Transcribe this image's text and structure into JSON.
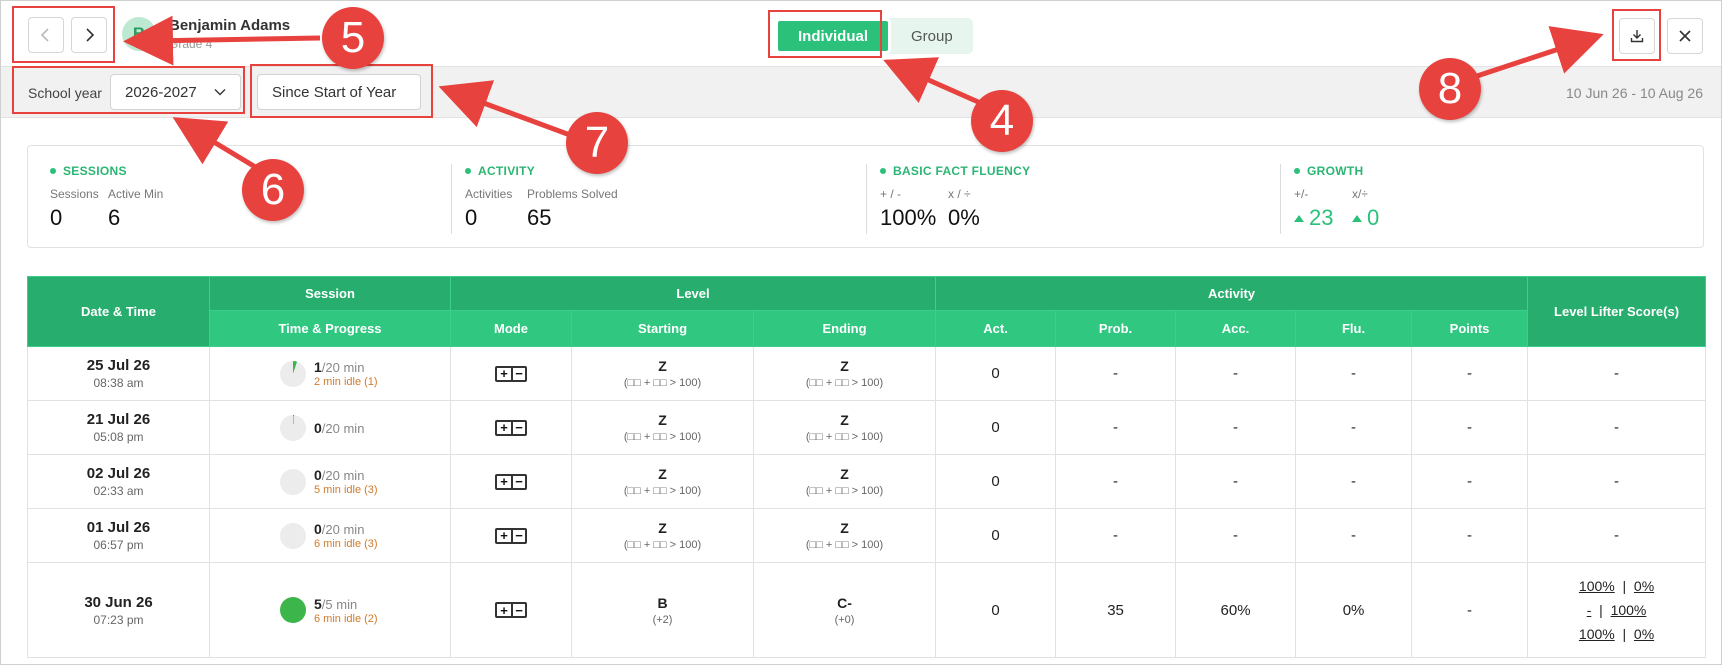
{
  "header": {
    "avatar_initial": "B",
    "student_name": "Benjamin Adams",
    "student_grade": "Grade 4",
    "toggle": {
      "individual": "Individual",
      "group": "Group"
    }
  },
  "filters": {
    "school_year_label": "School year",
    "school_year_value": "2026-2027",
    "period_value": "Since Start of Year",
    "date_range": "10 Jun 26 - 10 Aug 26"
  },
  "stats": {
    "sessions": {
      "title": "SESSIONS",
      "label1": "Sessions",
      "value1": "0",
      "label2": "Active Min",
      "value2": "6"
    },
    "activity": {
      "title": "ACTIVITY",
      "label1": "Activities",
      "value1": "0",
      "label2": "Problems Solved",
      "value2": "65"
    },
    "fluency": {
      "title": "BASIC FACT FLUENCY",
      "label1": "+ / -",
      "value1": "100%",
      "label2": "x / ÷",
      "value2": "0%"
    },
    "growth": {
      "title": "GROWTH",
      "label1": "+/-",
      "value1": "23",
      "label2": "x/÷",
      "value2": "0"
    }
  },
  "table": {
    "headers": {
      "datetime": "Date & Time",
      "session": "Session",
      "level": "Level",
      "activity": "Activity",
      "lls": "Level Lifter Score(s)",
      "time_progress": "Time & Progress",
      "mode": "Mode",
      "starting": "Starting",
      "ending": "Ending",
      "act": "Act.",
      "prob": "Prob.",
      "acc": "Acc.",
      "flu": "Flu.",
      "points": "Points"
    },
    "rows": [
      {
        "date": "25 Jul 26",
        "time": "08:38 am",
        "minutes": "1",
        "total": "/20 min",
        "idle": "2 min idle (1)",
        "progress": 0.05,
        "start": "Z",
        "start_sub": "(□□ + □□ > 100)",
        "end": "Z",
        "end_sub": "(□□ + □□ > 100)",
        "act": "0",
        "prob": "-",
        "acc": "-",
        "flu": "-",
        "points": "-",
        "lls": "-"
      },
      {
        "date": "21 Jul 26",
        "time": "05:08 pm",
        "minutes": "0",
        "total": "/20 min",
        "idle": "",
        "progress": 0.01,
        "start": "Z",
        "start_sub": "(□□ + □□ > 100)",
        "end": "Z",
        "end_sub": "(□□ + □□ > 100)",
        "act": "0",
        "prob": "-",
        "acc": "-",
        "flu": "-",
        "points": "-",
        "lls": "-"
      },
      {
        "date": "02 Jul 26",
        "time": "02:33 am",
        "minutes": "0",
        "total": "/20 min",
        "idle": "5 min idle (3)",
        "progress": 0,
        "start": "Z",
        "start_sub": "(□□ + □□ > 100)",
        "end": "Z",
        "end_sub": "(□□ + □□ > 100)",
        "act": "0",
        "prob": "-",
        "acc": "-",
        "flu": "-",
        "points": "-",
        "lls": "-"
      },
      {
        "date": "01 Jul 26",
        "time": "06:57 pm",
        "minutes": "0",
        "total": "/20 min",
        "idle": "6 min idle (3)",
        "progress": 0,
        "start": "Z",
        "start_sub": "(□□ + □□ > 100)",
        "end": "Z",
        "end_sub": "(□□ + □□ > 100)",
        "act": "0",
        "prob": "-",
        "acc": "-",
        "flu": "-",
        "points": "-",
        "lls": "-"
      },
      {
        "date": "30 Jun 26",
        "time": "07:23 pm",
        "minutes": "5",
        "total": "/5 min",
        "idle": "6 min idle (2)",
        "progress": 1,
        "start": "B",
        "start_sub": "(+2)",
        "end": "C-",
        "end_sub": "(+0)",
        "act": "0",
        "prob": "35",
        "acc": "60%",
        "flu": "0%",
        "points": "-",
        "lls_lines": [
          [
            "100%",
            "0%"
          ],
          [
            "-",
            "100%"
          ],
          [
            "100%",
            "0%"
          ]
        ]
      }
    ]
  },
  "annotations": [
    "5",
    "4",
    "6",
    "7",
    "8"
  ],
  "colors": {
    "accent": "#2bc17b",
    "header_dark": "#27ae6e",
    "header_light": "#30c781",
    "annotation": "#e8423f",
    "idle": "#d07a2a"
  }
}
